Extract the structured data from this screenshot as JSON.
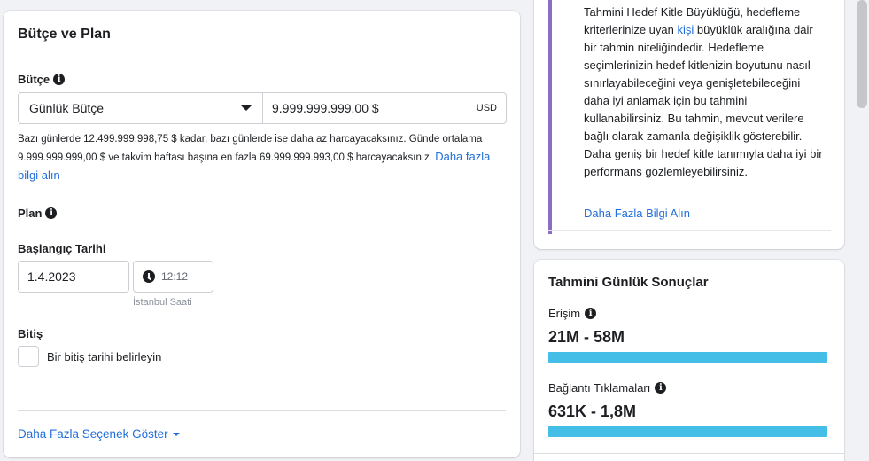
{
  "budget_card": {
    "title": "Bütçe ve Plan",
    "budget_label": "Bütçe",
    "budget_type": "Günlük Bütçe",
    "budget_amount": "9.999.999.999,00 $",
    "currency": "USD",
    "spend_note": "Bazı günlerde 12.499.999.998,75 $ kadar, bazı günlerde ise daha az harcayacaksınız. Günde ortalama 9.999.999.999,00 $ ve takvim haftası başına en fazla 69.999.999.993,00 $ harcayacaksınız.",
    "spend_note_link": "Daha fazla bilgi alın",
    "plan_label": "Plan",
    "start_date_label": "Başlangıç Tarihi",
    "start_date": "1.4.2023",
    "start_time": "12:12",
    "timezone": "İstanbul Saati",
    "end_label": "Bitiş",
    "end_checkbox_label": "Bir bitiş tarihi belirleyin",
    "more_options": "Daha Fazla Seçenek Göster"
  },
  "info_card": {
    "text_part1": "Tahmini Hedef Kitle Büyüklüğü, hedefleme kriterlerinize uyan",
    "text_link": "kişi",
    "text_part2": "büyüklük aralığına dair bir tahmin niteliğindedir. Hedefleme seçimlerinizin hedef kitlenizin boyutunu nasıl sınırlayabileceğini veya genişletebileceğini daha iyi anlamak için bu tahmini kullanabilirsiniz. Bu tahmin, mevcut verilere bağlı olarak zamanla değişiklik gösterebilir. Daha geniş bir hedef kitle tanımıyla daha iyi bir performans gözlemleyebilirsiniz.",
    "learn_more": "Daha Fazla Bilgi Alın",
    "accent_color": "#8b6ec4"
  },
  "results_card": {
    "title": "Tahmini Günlük Sonuçlar",
    "reach_label": "Erişim",
    "reach_value": "21M - 58M",
    "reach_fill": 1.0,
    "clicks_label": "Bağlantı Tıklamaları",
    "clicks_value": "631K - 1,8M",
    "clicks_fill": 1.0,
    "bar_color": "#44bee6"
  }
}
